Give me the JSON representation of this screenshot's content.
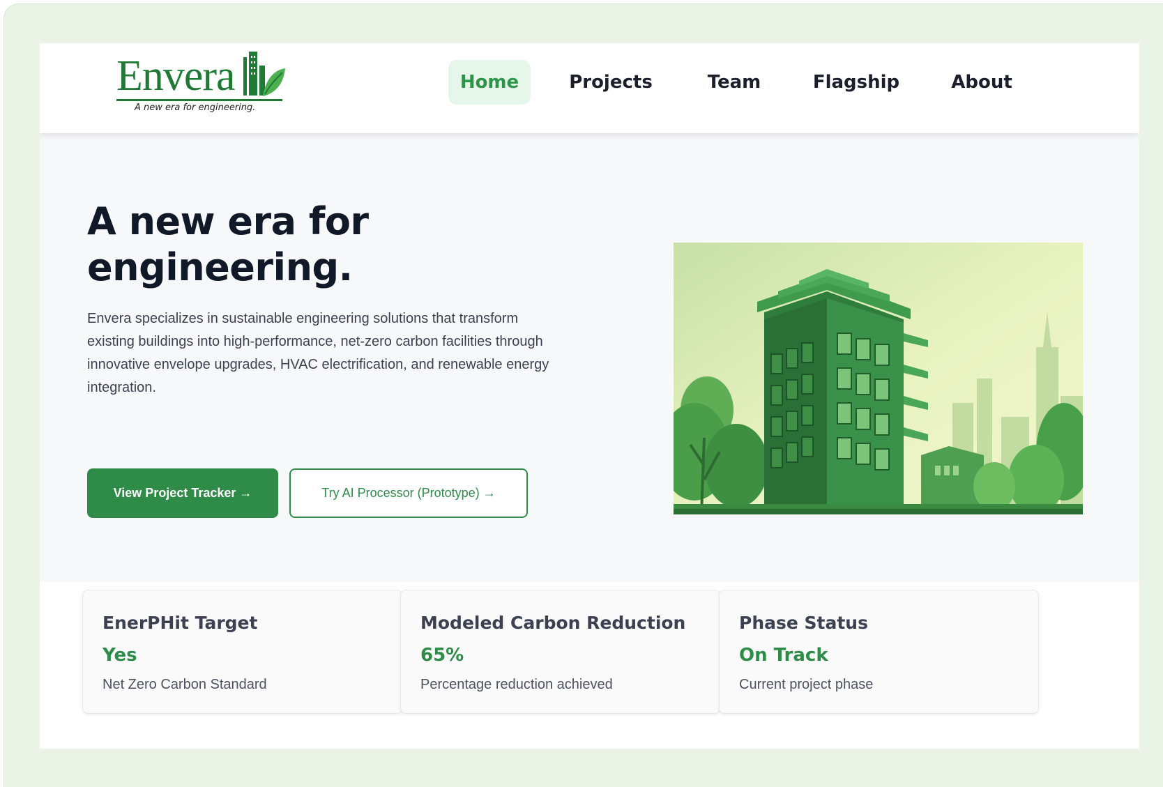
{
  "logo": {
    "word": "Envera",
    "tagline": "A new era for engineering."
  },
  "nav": {
    "items": [
      {
        "label": "Home",
        "active": true
      },
      {
        "label": "Projects",
        "active": false
      },
      {
        "label": "Team",
        "active": false
      },
      {
        "label": "Flagship",
        "active": false
      },
      {
        "label": "About",
        "active": false
      }
    ]
  },
  "hero": {
    "title": "A new era for engineering.",
    "description": "Envera specializes in sustainable engineering solutions that transform existing buildings into high-performance, net-zero carbon facilities through innovative envelope upgrades, HVAC electrification, and renewable energy integration.",
    "primary_button": "View Project Tracker →",
    "secondary_button": "Try AI Processor (Prototype) →",
    "image": "green-building-illustration"
  },
  "cards": [
    {
      "title": "EnerPHit Target",
      "value": "Yes",
      "subtitle": "Net Zero Carbon Standard"
    },
    {
      "title": "Modeled Carbon Reduction",
      "value": "65%",
      "subtitle": "Percentage reduction achieved"
    },
    {
      "title": "Phase Status",
      "value": "On Track",
      "subtitle": "Current project phase"
    }
  ],
  "colors": {
    "brand_green": "#2e8b48",
    "nav_active_bg": "#e7f6ea",
    "frame_bg": "#eaf3e6"
  }
}
